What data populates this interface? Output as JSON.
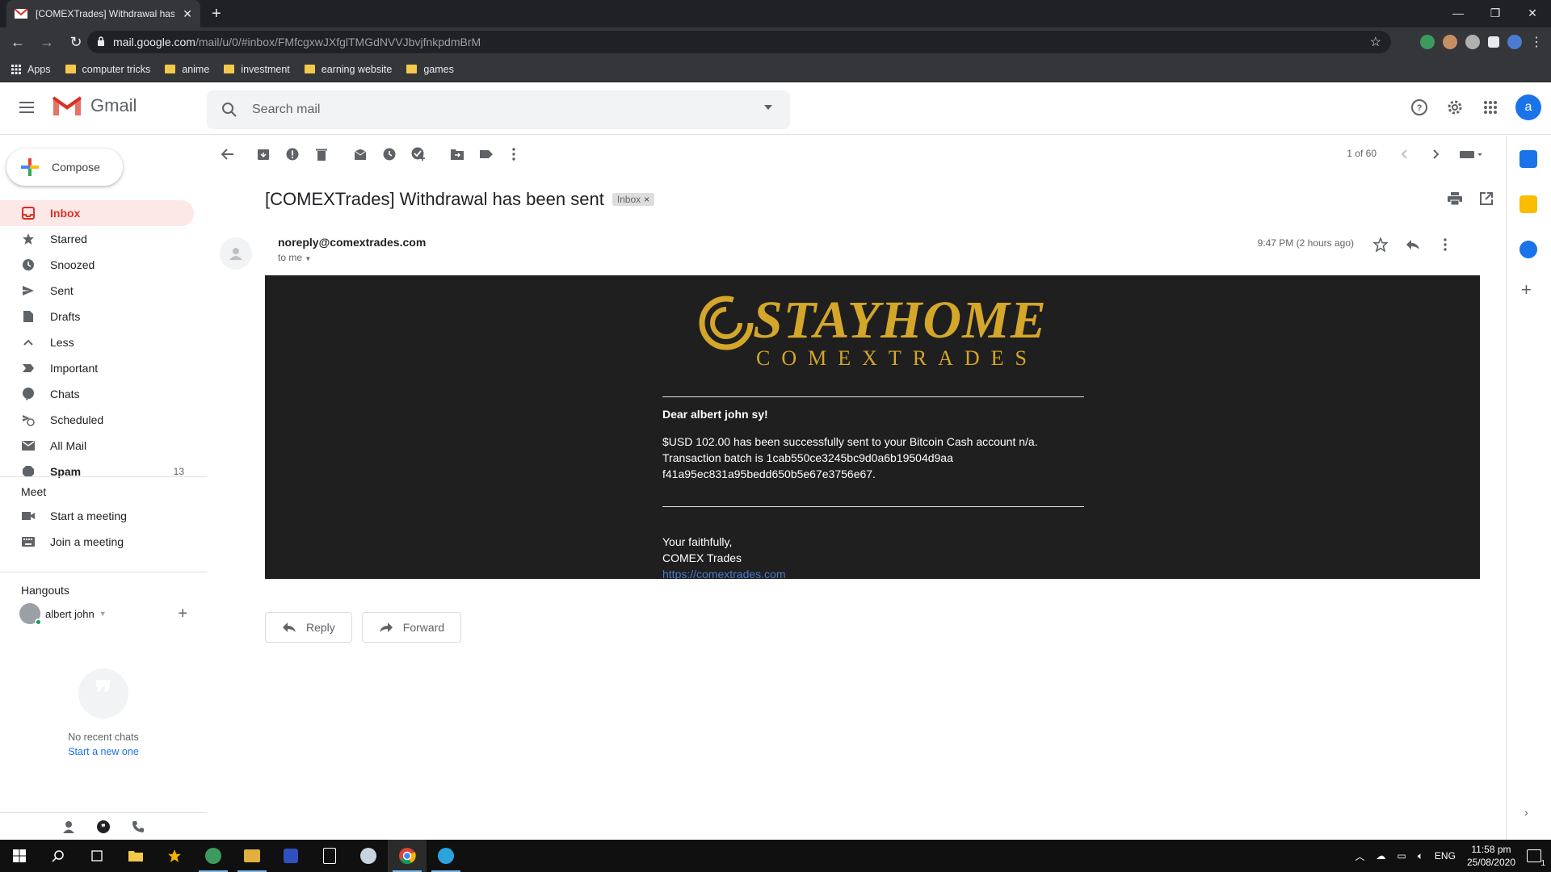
{
  "browser": {
    "tab_title": "[COMEXTrades] Withdrawal has b",
    "url_domain": "mail.google.com",
    "url_path": "/mail/u/0/#inbox/FMfcgxwJXfglTMGdNVVJbvjfnkpdmBrM",
    "bookmarks": [
      {
        "label": "Apps"
      },
      {
        "label": "computer tricks"
      },
      {
        "label": "anime"
      },
      {
        "label": "investment"
      },
      {
        "label": "earning website"
      },
      {
        "label": "games"
      }
    ]
  },
  "gmail": {
    "product_name": "Gmail",
    "search_placeholder": "Search mail",
    "avatar_letter": "a",
    "compose_label": "Compose",
    "nav": [
      {
        "label": "Inbox",
        "icon": "inbox-icon",
        "active": true,
        "count": ""
      },
      {
        "label": "Starred",
        "icon": "star-icon",
        "count": ""
      },
      {
        "label": "Snoozed",
        "icon": "clock-icon",
        "count": ""
      },
      {
        "label": "Sent",
        "icon": "send-icon",
        "count": ""
      },
      {
        "label": "Drafts",
        "icon": "draft-icon",
        "count": ""
      },
      {
        "label": "Less",
        "icon": "chevron-up-icon",
        "count": ""
      },
      {
        "label": "Important",
        "icon": "important-icon",
        "count": ""
      },
      {
        "label": "Chats",
        "icon": "chat-icon",
        "count": ""
      },
      {
        "label": "Scheduled",
        "icon": "scheduled-icon",
        "count": ""
      },
      {
        "label": "All Mail",
        "icon": "all-mail-icon",
        "count": ""
      },
      {
        "label": "Spam",
        "icon": "spam-icon",
        "count": "13"
      }
    ],
    "meet": {
      "title": "Meet",
      "items": [
        {
          "label": "Start a meeting",
          "icon": "video-icon"
        },
        {
          "label": "Join a meeting",
          "icon": "keyboard-icon"
        }
      ]
    },
    "hangouts": {
      "title": "Hangouts",
      "user": "albert john",
      "no_chats": "No recent chats",
      "start_new": "Start a new one"
    },
    "toolbar": {
      "pager": "1 of 60"
    },
    "message": {
      "subject": "[COMEXTrades] Withdrawal has been sent",
      "label": "Inbox",
      "from": "noreply@comextrades.com",
      "to": "to me",
      "time": "9:47 PM (2 hours ago)",
      "body": {
        "brand_top": "STAYHOME",
        "brand_bottom": "COMEXTRADES",
        "greeting": "Dear albert john sy!",
        "line1": "$USD 102.00 has been successfully sent to your Bitcoin Cash account n/a.",
        "line2": "Transaction batch is 1cab550ce3245bc9d0a6b19504d9aa",
        "line3": "f41a95ec831a95bedd650b5e67e3756e67.",
        "sign1": "Your faithfully,",
        "sign2": "COMEX Trades",
        "link": "https://comextrades.com"
      },
      "reply_label": "Reply",
      "forward_label": "Forward"
    }
  },
  "taskbar": {
    "lang": "ENG",
    "time": "11:58 pm",
    "date": "25/08/2020",
    "notif_count": "1"
  },
  "colors": {
    "gmail_red": "#d93025",
    "accent_blue": "#1a73e8",
    "gold": "#d4a62a",
    "email_bg": "#1f1f1f"
  }
}
